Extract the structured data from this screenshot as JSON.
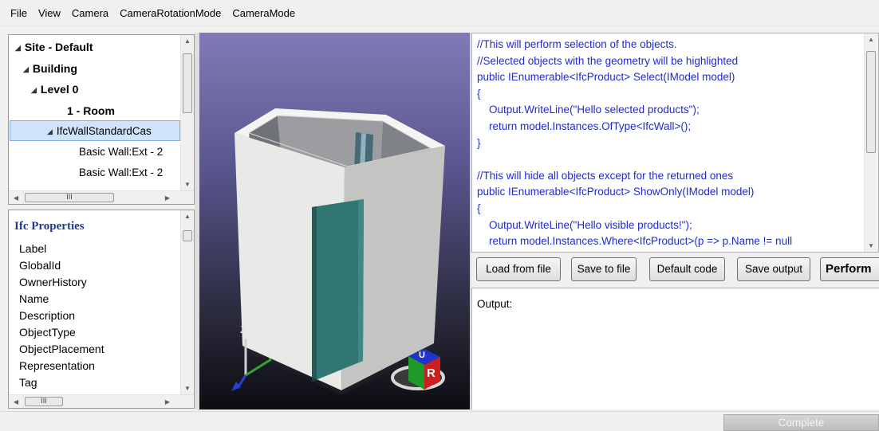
{
  "menu": [
    "File",
    "View",
    "Camera",
    "CameraRotationMode",
    "CameraMode"
  ],
  "tree": {
    "items": [
      {
        "label": "Site - Default",
        "bold": true,
        "expanded": true
      },
      {
        "label": "Building",
        "bold": true,
        "expanded": true
      },
      {
        "label": "Level 0",
        "bold": true,
        "expanded": true
      },
      {
        "label": "1 - Room",
        "bold": true
      },
      {
        "label": "IfcWallStandardCas",
        "expanded": true,
        "selected": true
      },
      {
        "label": "Basic Wall:Ext - 2"
      },
      {
        "label": "Basic Wall:Ext - 2"
      }
    ],
    "hscroll_glyph": "III"
  },
  "properties": {
    "title": "Ifc Properties",
    "items": [
      "Label",
      "GlobalId",
      "OwnerHistory",
      "Name",
      "Description",
      "ObjectType",
      "ObjectPlacement",
      "Representation",
      "Tag"
    ],
    "hscroll_glyph": "III"
  },
  "viewport": {
    "axis_labels": {
      "z": "Z",
      "y": "Y"
    },
    "view_cube": {
      "top": "U",
      "right": "R"
    },
    "colors": {
      "wall": "#e9e9e7",
      "door": "#2f7770",
      "cube_red": "#cc1f1f",
      "cube_blue": "#2233cc",
      "cube_green": "#1e9a2a"
    }
  },
  "code": {
    "lines": [
      "//This will perform selection of the objects.",
      "//Selected objects with the geometry will be highlighted",
      "public IEnumerable<IfcProduct> Select(IModel model)",
      "{",
      "    Output.WriteLine(\"Hello selected products\");",
      "    return model.Instances.OfType<IfcWall>();",
      "}",
      "",
      "//This will hide all objects except for the returned ones",
      "public IEnumerable<IfcProduct> ShowOnly(IModel model)",
      "{",
      "    Output.WriteLine(\"Hello visible products!\");",
      "    return model.Instances.Where<IfcProduct>(p => p.Name != null"
    ],
    "text_color": "#1f2bd0"
  },
  "buttons": {
    "load": "Load from file",
    "save": "Save to file",
    "default": "Default code",
    "save_output": "Save output",
    "perform": "Perform"
  },
  "output": {
    "label": "Output:"
  },
  "status": {
    "progress_label": "Complete",
    "progress_value": 1.0
  }
}
